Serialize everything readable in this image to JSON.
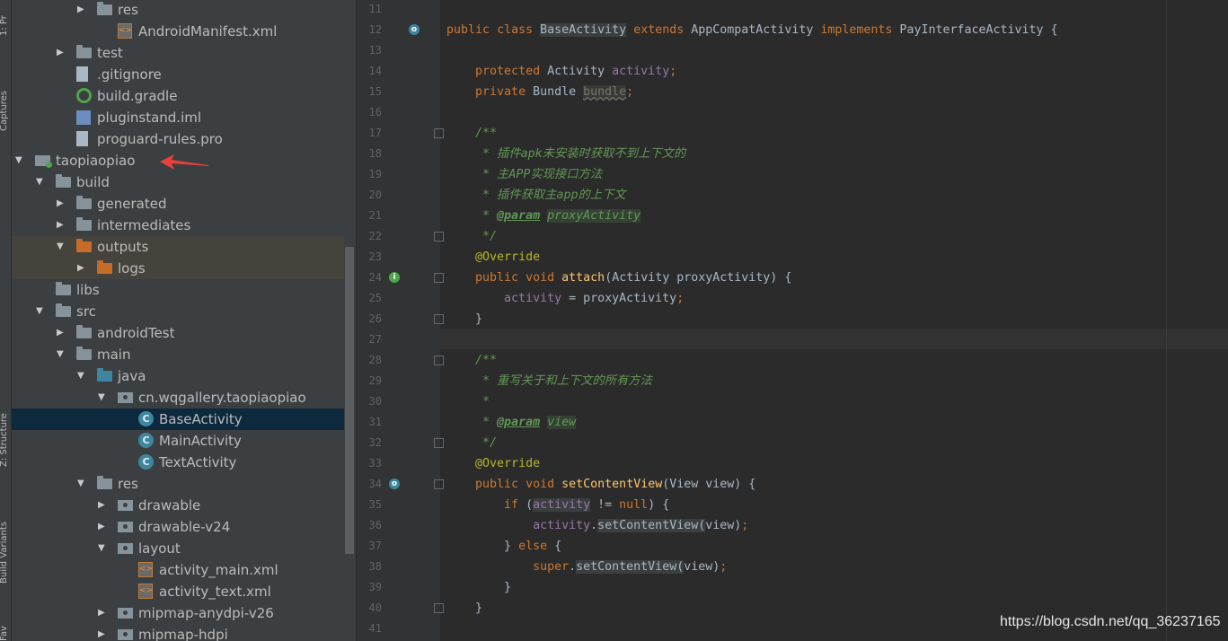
{
  "side_tabs": [
    "1: Pr",
    "Captures",
    "Z: Structure",
    "Build Variants",
    "Fav"
  ],
  "project_tree": [
    {
      "label": "res",
      "icon": "res-folder-icon",
      "depth": 5,
      "arrow": "right"
    },
    {
      "label": "AndroidManifest.xml",
      "icon": "manifest-icon",
      "depth": 6,
      "arrow": ""
    },
    {
      "label": "test",
      "icon": "folder-icon",
      "depth": 4,
      "arrow": "right"
    },
    {
      "label": ".gitignore",
      "icon": "file-icon",
      "depth": 4,
      "arrow": ""
    },
    {
      "label": "build.gradle",
      "icon": "gradle-icon",
      "depth": 4,
      "arrow": ""
    },
    {
      "label": "pluginstand.iml",
      "icon": "iml-icon",
      "depth": 4,
      "arrow": ""
    },
    {
      "label": "proguard-rules.pro",
      "icon": "file-icon",
      "depth": 4,
      "arrow": ""
    },
    {
      "label": "taopiaopiao",
      "icon": "module-icon",
      "depth": 2,
      "arrow": "down"
    },
    {
      "label": "build",
      "icon": "folder-icon",
      "depth": 3,
      "arrow": "down"
    },
    {
      "label": "generated",
      "icon": "folder-icon",
      "depth": 4,
      "arrow": "right"
    },
    {
      "label": "intermediates",
      "icon": "folder-icon",
      "depth": 4,
      "arrow": "right"
    },
    {
      "label": "outputs",
      "icon": "orange-folder-icon",
      "depth": 4,
      "arrow": "down"
    },
    {
      "label": "logs",
      "icon": "orange-folder-icon",
      "depth": 5,
      "arrow": "right"
    },
    {
      "label": "libs",
      "icon": "folder-icon",
      "depth": 3,
      "arrow": ""
    },
    {
      "label": "src",
      "icon": "folder-icon",
      "depth": 3,
      "arrow": "down"
    },
    {
      "label": "androidTest",
      "icon": "folder-icon",
      "depth": 4,
      "arrow": "right"
    },
    {
      "label": "main",
      "icon": "folder-icon",
      "depth": 4,
      "arrow": "down"
    },
    {
      "label": "java",
      "icon": "blue-folder-icon",
      "depth": 5,
      "arrow": "down"
    },
    {
      "label": "cn.wqgallery.taopiaopiao",
      "icon": "package-icon",
      "depth": 6,
      "arrow": "down"
    },
    {
      "label": "BaseActivity",
      "icon": "class-icon",
      "depth": 7,
      "arrow": ""
    },
    {
      "label": "MainActivity",
      "icon": "class-icon",
      "depth": 7,
      "arrow": ""
    },
    {
      "label": "TextActivity",
      "icon": "class-icon",
      "depth": 7,
      "arrow": ""
    },
    {
      "label": "res",
      "icon": "res-folder-icon",
      "depth": 5,
      "arrow": "down"
    },
    {
      "label": "drawable",
      "icon": "package-icon",
      "depth": 6,
      "arrow": "right"
    },
    {
      "label": "drawable-v24",
      "icon": "package-icon",
      "depth": 6,
      "arrow": "right"
    },
    {
      "label": "layout",
      "icon": "package-icon",
      "depth": 6,
      "arrow": "down"
    },
    {
      "label": "activity_main.xml",
      "icon": "layout-xml-icon",
      "depth": 7,
      "arrow": ""
    },
    {
      "label": "activity_text.xml",
      "icon": "layout-xml-icon",
      "depth": 7,
      "arrow": ""
    },
    {
      "label": "mipmap-anydpi-v26",
      "icon": "package-icon",
      "depth": 6,
      "arrow": "right"
    },
    {
      "label": "mipmap-hdpi",
      "icon": "package-icon",
      "depth": 6,
      "arrow": "right"
    }
  ],
  "selected_item": "BaseActivity",
  "highlighted_item": "outputs",
  "editor": {
    "line_numbers": [
      "11",
      "12",
      "13",
      "14",
      "15",
      "16",
      "17",
      "18",
      "19",
      "20",
      "21",
      "22",
      "23",
      "24",
      "25",
      "26",
      "27",
      "28",
      "29",
      "30",
      "31",
      "32",
      "33",
      "34",
      "35",
      "36",
      "37",
      "38",
      "39",
      "40",
      "41"
    ],
    "lines": [
      "",
      "public class BaseActivity extends AppCompatActivity implements PayInterfaceActivity {",
      "",
      "    protected Activity activity;",
      "    private Bundle bundle;",
      "",
      "    /**",
      "     * 插件apk未安装时获取不到上下文的",
      "     * 主APP实现接口方法",
      "     * 插件获取主app的上下文",
      "     * @param proxyActivity",
      "     */",
      "    @Override",
      "    public void attach(Activity proxyActivity) {",
      "        activity = proxyActivity;",
      "    }",
      "",
      "    /**",
      "     * 重写关于和上下文的所有方法",
      "     *",
      "     * @param view",
      "     */",
      "    @Override",
      "    public void setContentView(View view) {",
      "        if (activity != null) {",
      "            activity.setContentView(view);",
      "        } else {",
      "            super.setContentView(view);",
      "        }",
      "    }",
      ""
    ]
  },
  "watermark": "https://blog.csdn.net/qq_36237165",
  "colors": {
    "keyword": "#cc7832",
    "comment": "#629755",
    "annotation": "#bbb529",
    "field": "#9876aa",
    "method": "#ffc66d",
    "text": "#a9b7c6",
    "selection": "#0d293e",
    "red_arrow": "#e8413a"
  }
}
